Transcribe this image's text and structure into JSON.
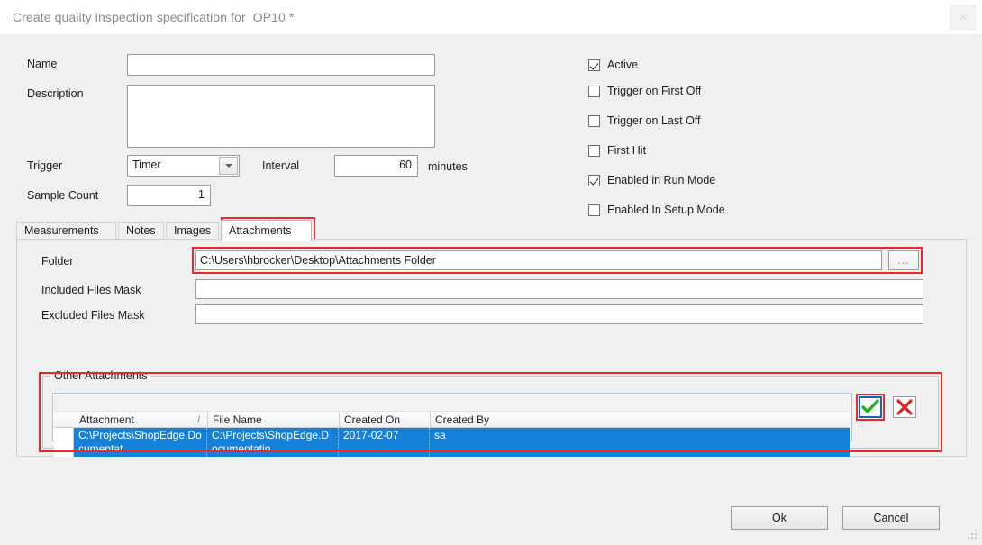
{
  "window": {
    "title": "Create quality inspection specification for  OP10 *",
    "close_label": "✕"
  },
  "form": {
    "name_label": "Name",
    "name_value": "",
    "description_label": "Description",
    "description_value": "",
    "trigger_label": "Trigger",
    "trigger_value": "Timer",
    "trigger_options": [
      "Timer"
    ],
    "interval_label": "Interval",
    "interval_value": "60",
    "interval_units": "minutes",
    "sample_count_label": "Sample Count",
    "sample_count_value": "1"
  },
  "options": [
    {
      "label": "Active",
      "checked": true
    },
    {
      "label": "Trigger on First Off",
      "checked": false
    },
    {
      "label": "Trigger on Last Off",
      "checked": false
    },
    {
      "label": "First Hit",
      "checked": false
    },
    {
      "label": "Enabled in Run Mode",
      "checked": true
    },
    {
      "label": "Enabled In Setup Mode",
      "checked": false
    }
  ],
  "tabs": [
    {
      "label": "Measurements",
      "selected": false
    },
    {
      "label": "Notes",
      "selected": false
    },
    {
      "label": "Images",
      "selected": false
    },
    {
      "label": "Attachments",
      "selected": true
    }
  ],
  "attachments_tab": {
    "folder_label": "Folder",
    "folder_value": "C:\\Users\\hbrocker\\Desktop\\Attachments Folder",
    "browse_label": "...",
    "included_label": "Included Files Mask",
    "included_value": "",
    "excluded_label": "Excluded Files Mask",
    "excluded_value": "",
    "group_title": "Other Attachments",
    "grid": {
      "columns": [
        "Attachment",
        "File Name",
        "Created On",
        "Created By"
      ],
      "sort_column": "Attachment",
      "sort_indicator": "/",
      "rows": [
        {
          "attachment": "C:\\Projects\\ShopEdge.Documentat",
          "file_name": "C:\\Projects\\ShopEdge.Documentatio",
          "created_on": "2017-02-07",
          "created_by": "sa",
          "selected": true
        }
      ]
    },
    "accept_button": "accept-icon",
    "delete_button": "delete-icon"
  },
  "footer": {
    "ok_label": "Ok",
    "cancel_label": "Cancel"
  },
  "colors": {
    "highlight_red": "#ef2727",
    "row_selection_blue": "#1581d8",
    "accept_green": "#1eb01e",
    "delete_red": "#e02020",
    "focus_blue": "#1565c0"
  }
}
